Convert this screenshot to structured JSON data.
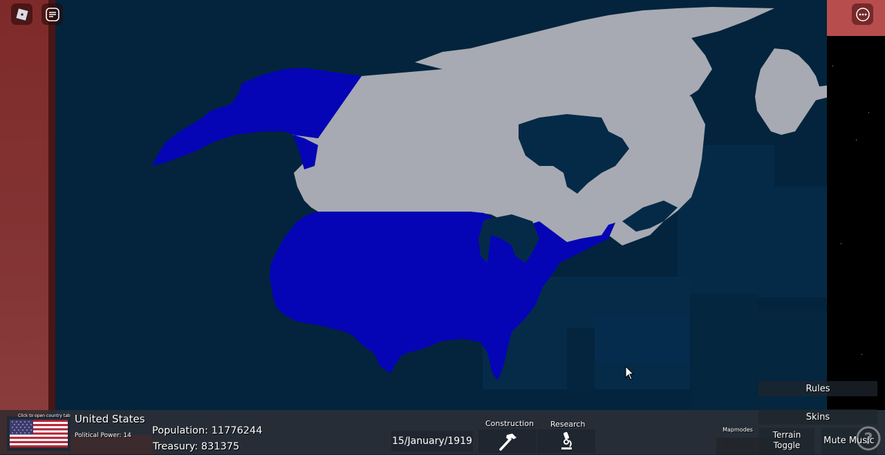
{
  "topbar": {
    "roblox_menu_icon": "roblox-logo-icon",
    "chat_icon": "chat-icon",
    "more_icon": "more-options-icon"
  },
  "country": {
    "tooltip": "Click to open country tab",
    "name": "United States",
    "political_power_label": "Political Power: 14",
    "flag": "us-flag"
  },
  "stats": {
    "population": "Population: 11776244",
    "treasury": "Treasury: 831375"
  },
  "date": "15/January/1919",
  "actions": [
    {
      "label": "Construction",
      "icon": "hammer-icon"
    },
    {
      "label": "Research",
      "icon": "microscope-icon"
    }
  ],
  "menu": {
    "rules": "Rules",
    "skins": "Skins",
    "mapmodes": "Mapmodes",
    "terrain_toggle_line1": "Terrain",
    "terrain_toggle_line2": "Toggle",
    "mute_music": "Mute Music",
    "help_icon": "help-icon"
  },
  "map": {
    "player_color": "#0505b5",
    "other_color": "#a7aab2",
    "ocean_color": "#03243c",
    "regions": [
      {
        "name": "United States",
        "color": "#0505b5"
      },
      {
        "name": "Alaska (US)",
        "color": "#0505b5"
      },
      {
        "name": "Canada",
        "color": "#a7aab2"
      },
      {
        "name": "Greenland",
        "color": "#a7aab2"
      }
    ]
  }
}
